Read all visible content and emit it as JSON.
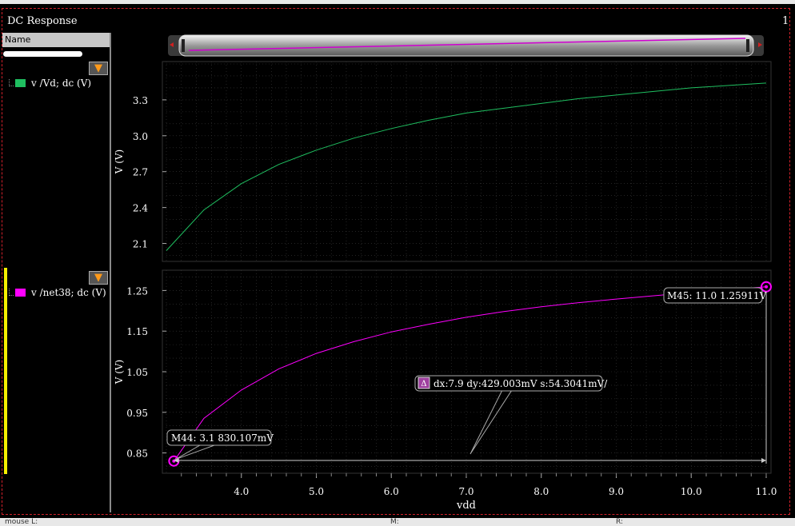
{
  "window": {
    "title": "DC Response",
    "page_number": "1"
  },
  "sidebar": {
    "header": "Name",
    "traces": [
      {
        "label": "v /Vd; dc (V)",
        "color": "#1fbf60"
      },
      {
        "label": "v /net38; dc (V)",
        "color": "#ff00ff"
      }
    ],
    "filter_icon": "funnel-icon"
  },
  "statusbar": {
    "left": "mouse L:",
    "middle": "M:",
    "right": "R:"
  },
  "colors": {
    "background": "#000000",
    "grid": "#3a3a3a",
    "trace_vd": "#1fbf60",
    "trace_net38": "#ff00ff",
    "frame": "#d0202a"
  },
  "chart_data": [
    {
      "type": "line",
      "series": [
        {
          "name": "v /Vd; dc (V)",
          "x": [
            3.0,
            3.5,
            4.0,
            4.5,
            5.0,
            5.5,
            6.0,
            6.5,
            7.0,
            7.5,
            8.0,
            8.5,
            9.0,
            9.5,
            10.0,
            10.5,
            11.0
          ],
          "y": [
            2.04,
            2.38,
            2.6,
            2.76,
            2.88,
            2.98,
            3.06,
            3.13,
            3.19,
            3.23,
            3.27,
            3.31,
            3.34,
            3.37,
            3.4,
            3.42,
            3.44
          ]
        }
      ],
      "ylabel": "V (V)",
      "yticks": [
        2.1,
        2.4,
        2.7,
        3.0,
        3.3
      ],
      "ytick_labels": [
        "2.1",
        "2.4",
        "2.7",
        "3.0",
        "3.3"
      ],
      "ylim": [
        1.95,
        3.62
      ],
      "xlim": [
        3.0,
        11.0
      ],
      "grid": true
    },
    {
      "type": "line",
      "series": [
        {
          "name": "v /net38; dc (V)",
          "x": [
            3.1,
            3.5,
            4.0,
            4.5,
            5.0,
            5.5,
            6.0,
            6.5,
            7.0,
            7.5,
            8.0,
            8.5,
            9.0,
            9.5,
            10.0,
            10.5,
            11.0
          ],
          "y": [
            0.83,
            0.935,
            1.005,
            1.057,
            1.095,
            1.124,
            1.148,
            1.167,
            1.184,
            1.198,
            1.21,
            1.22,
            1.229,
            1.237,
            1.245,
            1.252,
            1.259
          ]
        }
      ],
      "xlabel": "vdd",
      "ylabel": "V (V)",
      "xticks": [
        4.0,
        5.0,
        6.0,
        7.0,
        8.0,
        9.0,
        10.0,
        11.0
      ],
      "xtick_labels": [
        "4.0",
        "5.0",
        "6.0",
        "7.0",
        "8.0",
        "9.0",
        "10.0",
        "11.0"
      ],
      "yticks": [
        0.85,
        0.95,
        1.05,
        1.15,
        1.25
      ],
      "ytick_labels": [
        "0.85",
        "0.95",
        "1.05",
        "1.15",
        "1.25"
      ],
      "ylim": [
        0.8,
        1.3
      ],
      "xlim": [
        3.0,
        11.0
      ],
      "grid": true,
      "markers": [
        {
          "label": "M44: 3.1 830.107mV",
          "x": 3.1,
          "y": 0.830107
        },
        {
          "label": "M45: 11.0 1.25911V",
          "x": 11.0,
          "y": 1.25911
        }
      ],
      "delta_label": "dx:7.9 dy:429.003mV s:54.3041mV/",
      "delta_icon": "delta-icon"
    }
  ]
}
